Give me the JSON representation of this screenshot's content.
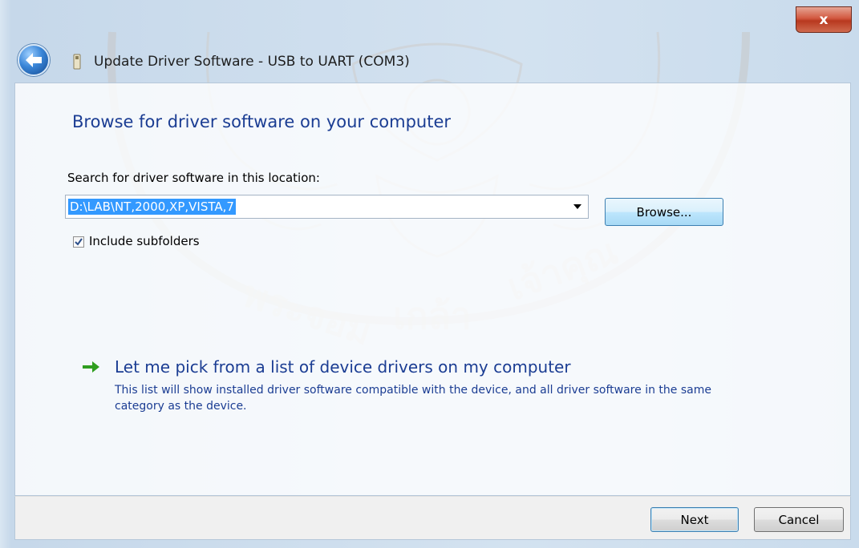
{
  "window": {
    "title": "Update Driver Software - USB to UART (COM3)",
    "close_glyph": "x"
  },
  "main": {
    "heading": "Browse for driver software on your computer",
    "search_label": "Search for driver software in this location:",
    "path_value": "D:\\LAB\\NT,2000,XP,VISTA,7",
    "browse_label": "Browse...",
    "include_subfolders_label": "Include subfolders",
    "include_subfolders_checked": true,
    "pick_link": "Let me pick from a list of device drivers on my computer",
    "pick_description": "This list will show installed driver software compatible with the device, and all driver software in the same category as the device."
  },
  "footer": {
    "next_label": "Next",
    "cancel_label": "Cancel"
  },
  "colors": {
    "heading_blue": "#1b3d93",
    "selection_blue": "#3399ff",
    "link_arrow_green": "#2f9e1f",
    "close_red": "#c8452c"
  },
  "icons": {
    "back": "back-arrow-icon",
    "wizard": "usb-device-icon",
    "link_arrow": "green-arrow-icon",
    "checkbox": "checkmark-icon"
  }
}
